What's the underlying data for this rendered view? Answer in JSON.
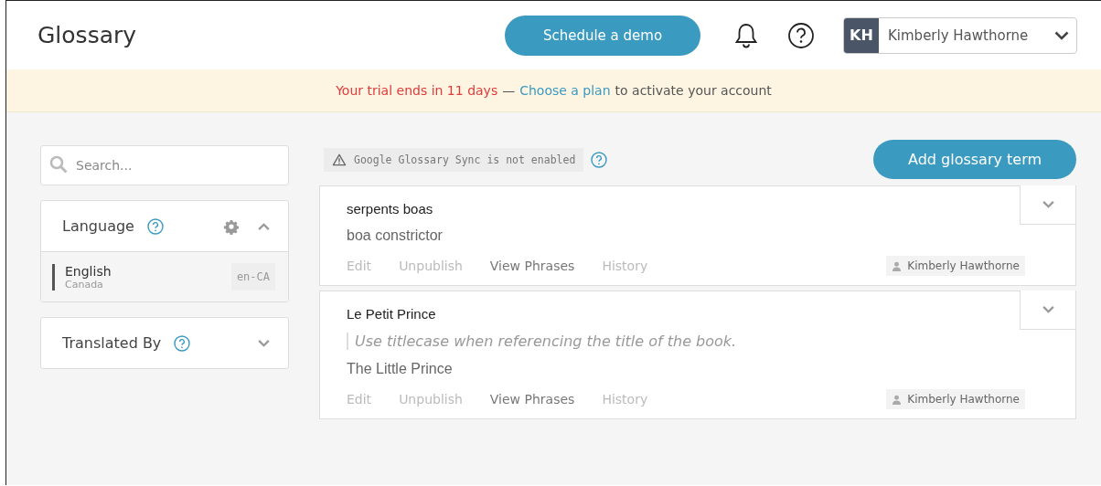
{
  "header": {
    "title": "Glossary",
    "demo_button": "Schedule a demo",
    "user": {
      "initials": "KH",
      "name": "Kimberly Hawthorne"
    }
  },
  "banner": {
    "warning": "Your trial ends in 11 days",
    "separator": "—",
    "link": "Choose a plan",
    "rest": "to activate your account"
  },
  "sidebar": {
    "search": {
      "placeholder": "Search..."
    },
    "panels": [
      {
        "title": "Language",
        "expanded": true,
        "settings": true,
        "items": [
          {
            "name": "English",
            "region": "Canada",
            "code": "en-CA",
            "selected": true
          }
        ]
      },
      {
        "title": "Translated By",
        "expanded": false,
        "settings": false
      }
    ]
  },
  "sync_notice": "Google Glossary Sync is not enabled",
  "add_button": "Add glossary term",
  "terms": [
    {
      "term": "serpents boas",
      "translation": "boa constrictor",
      "actions": [
        {
          "label": "Edit",
          "disabled": true
        },
        {
          "label": "Unpublish",
          "disabled": true
        },
        {
          "label": "View Phrases",
          "disabled": false
        },
        {
          "label": "History",
          "disabled": true
        }
      ],
      "author": "Kimberly Hawthorne"
    },
    {
      "term": "Le Petit Prince",
      "note": "Use titlecase when referencing the title of the book.",
      "translation": "The Little Prince",
      "actions": [
        {
          "label": "Edit",
          "disabled": true
        },
        {
          "label": "Unpublish",
          "disabled": true
        },
        {
          "label": "View Phrases",
          "disabled": false
        },
        {
          "label": "History",
          "disabled": true
        }
      ],
      "author": "Kimberly Hawthorne"
    }
  ]
}
